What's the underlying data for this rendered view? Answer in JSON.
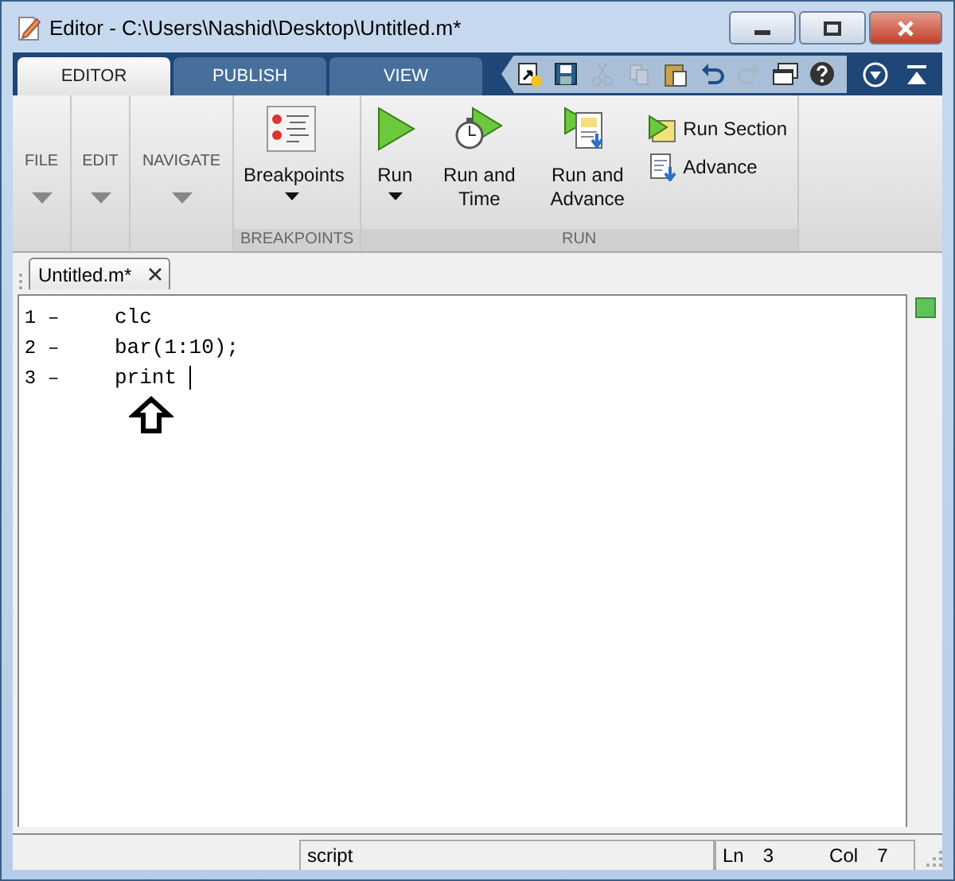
{
  "window": {
    "title": "Editor - C:\\Users\\Nashid\\Desktop\\Untitled.m*"
  },
  "tabs": [
    {
      "label": "EDITOR",
      "selected": true
    },
    {
      "label": "PUBLISH",
      "selected": false
    },
    {
      "label": "VIEW",
      "selected": false
    }
  ],
  "quick_access": [
    {
      "kind": "new",
      "disabled": false
    },
    {
      "kind": "save",
      "disabled": false
    },
    {
      "kind": "cut",
      "disabled": true
    },
    {
      "kind": "copy",
      "disabled": true
    },
    {
      "kind": "paste",
      "disabled": false
    },
    {
      "kind": "undo",
      "disabled": false
    },
    {
      "kind": "redo",
      "disabled": true
    },
    {
      "kind": "windows",
      "disabled": false
    },
    {
      "kind": "help",
      "disabled": false
    }
  ],
  "collapsed_sections": [
    {
      "label": "FILE"
    },
    {
      "label": "EDIT"
    },
    {
      "label": "NAVIGATE"
    }
  ],
  "groups": [
    {
      "label": "BREAKPOINTS",
      "large": [
        {
          "kind": "breakpoints",
          "label": "Breakpoints",
          "dropdown": true
        }
      ]
    },
    {
      "label": "RUN",
      "large": [
        {
          "kind": "run",
          "label": "Run",
          "dropdown": true
        },
        {
          "kind": "run-time",
          "label": "Run and Time",
          "dropdown": false
        },
        {
          "kind": "run-advance",
          "label": "Run and Advance",
          "dropdown": false
        }
      ],
      "small": [
        {
          "kind": "run-section",
          "label": "Run Section"
        },
        {
          "kind": "advance",
          "label": "Advance"
        }
      ]
    }
  ],
  "document_tabs": [
    {
      "label": "Untitled.m*",
      "selected": true
    }
  ],
  "editor": {
    "lines": [
      {
        "number": "1",
        "marker": "–",
        "code": "clc"
      },
      {
        "number": "2",
        "marker": "–",
        "code": "bar(1:10);"
      },
      {
        "number": "3",
        "marker": "–",
        "code": "print ",
        "cursor": true
      }
    ]
  },
  "status_bar": {
    "type": "script",
    "line_label": "Ln",
    "line": "3",
    "col_label": "Col",
    "col": "7"
  }
}
